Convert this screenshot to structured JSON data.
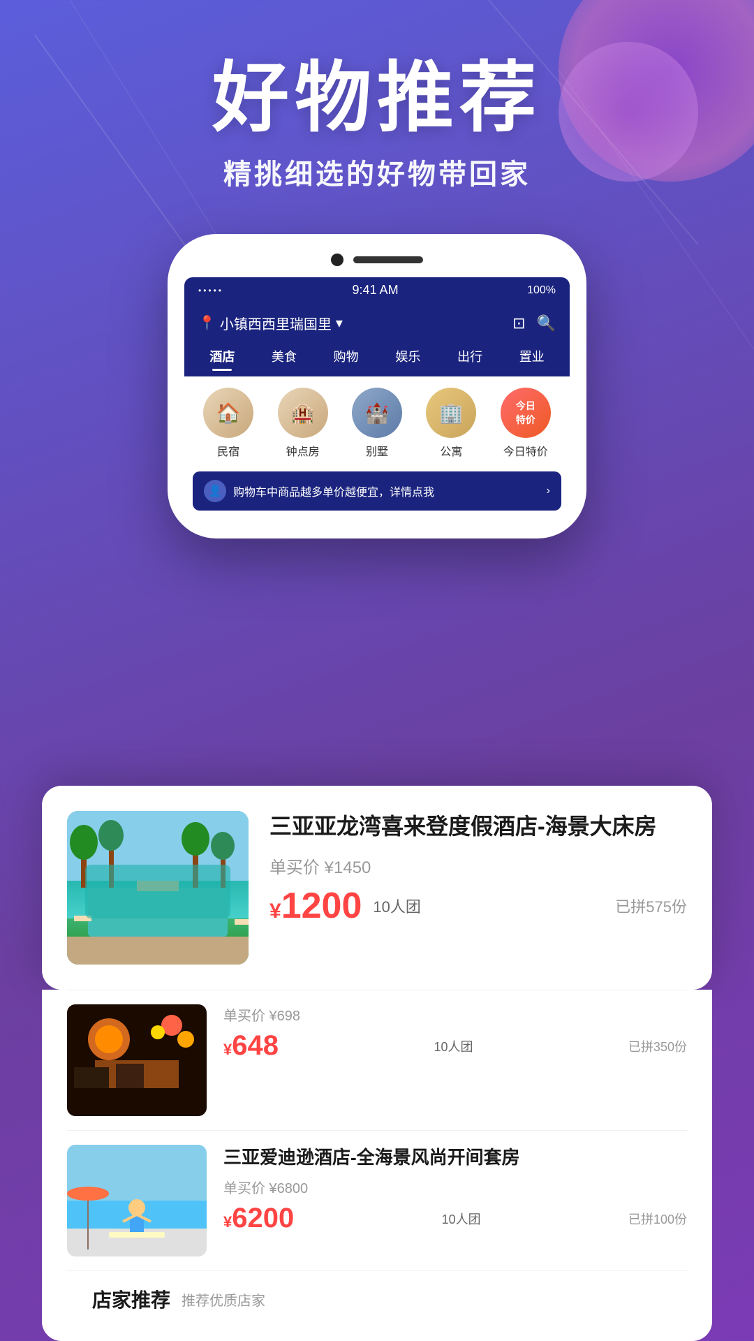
{
  "hero": {
    "title": "好物推荐",
    "subtitle": "精挑细选的好物带回家"
  },
  "phone": {
    "status_bar": {
      "time": "9:41 AM",
      "battery": "100%",
      "signal_dots": "•••••"
    },
    "nav": {
      "location": "小镇西西里瑞国里",
      "dropdown_icon": "▾"
    },
    "tabs": [
      {
        "label": "酒店",
        "active": true
      },
      {
        "label": "美食",
        "active": false
      },
      {
        "label": "购物",
        "active": false
      },
      {
        "label": "娱乐",
        "active": false
      },
      {
        "label": "出行",
        "active": false
      },
      {
        "label": "置业",
        "active": false
      }
    ],
    "categories": [
      {
        "label": "民宿",
        "key": "minshu"
      },
      {
        "label": "钟点房",
        "key": "zhongdian"
      },
      {
        "label": "别墅",
        "key": "bieshu"
      },
      {
        "label": "公寓",
        "key": "gongyu"
      },
      {
        "label": "今日特价",
        "key": "special"
      }
    ],
    "promo_banner": {
      "text": "购物车中商品越多单价越便宜，详情点我",
      "arrow": "›"
    }
  },
  "products": [
    {
      "title": "三亚亚龙湾喜来登度假酒店-海景大床房",
      "original_price": "单买价 ¥1450",
      "sale_price": "1200",
      "currency": "¥",
      "group_size": "10人团",
      "sold_count": "已拼575份",
      "image_type": "pool"
    },
    {
      "title": "",
      "original_price": "单买价 ¥698",
      "sale_price": "648",
      "currency": "¥",
      "group_size": "10人团",
      "sold_count": "已拼350份",
      "image_type": "food"
    },
    {
      "title": "三亚爱迪逊酒店-全海景风尚开间套房",
      "original_price": "单买价 ¥6800",
      "sale_price": "6200",
      "currency": "¥",
      "group_size": "10人团",
      "sold_count": "已拼100份",
      "image_type": "beach"
    }
  ],
  "store_section": {
    "title": "店家推荐",
    "subtitle": "推荐优质店家"
  }
}
